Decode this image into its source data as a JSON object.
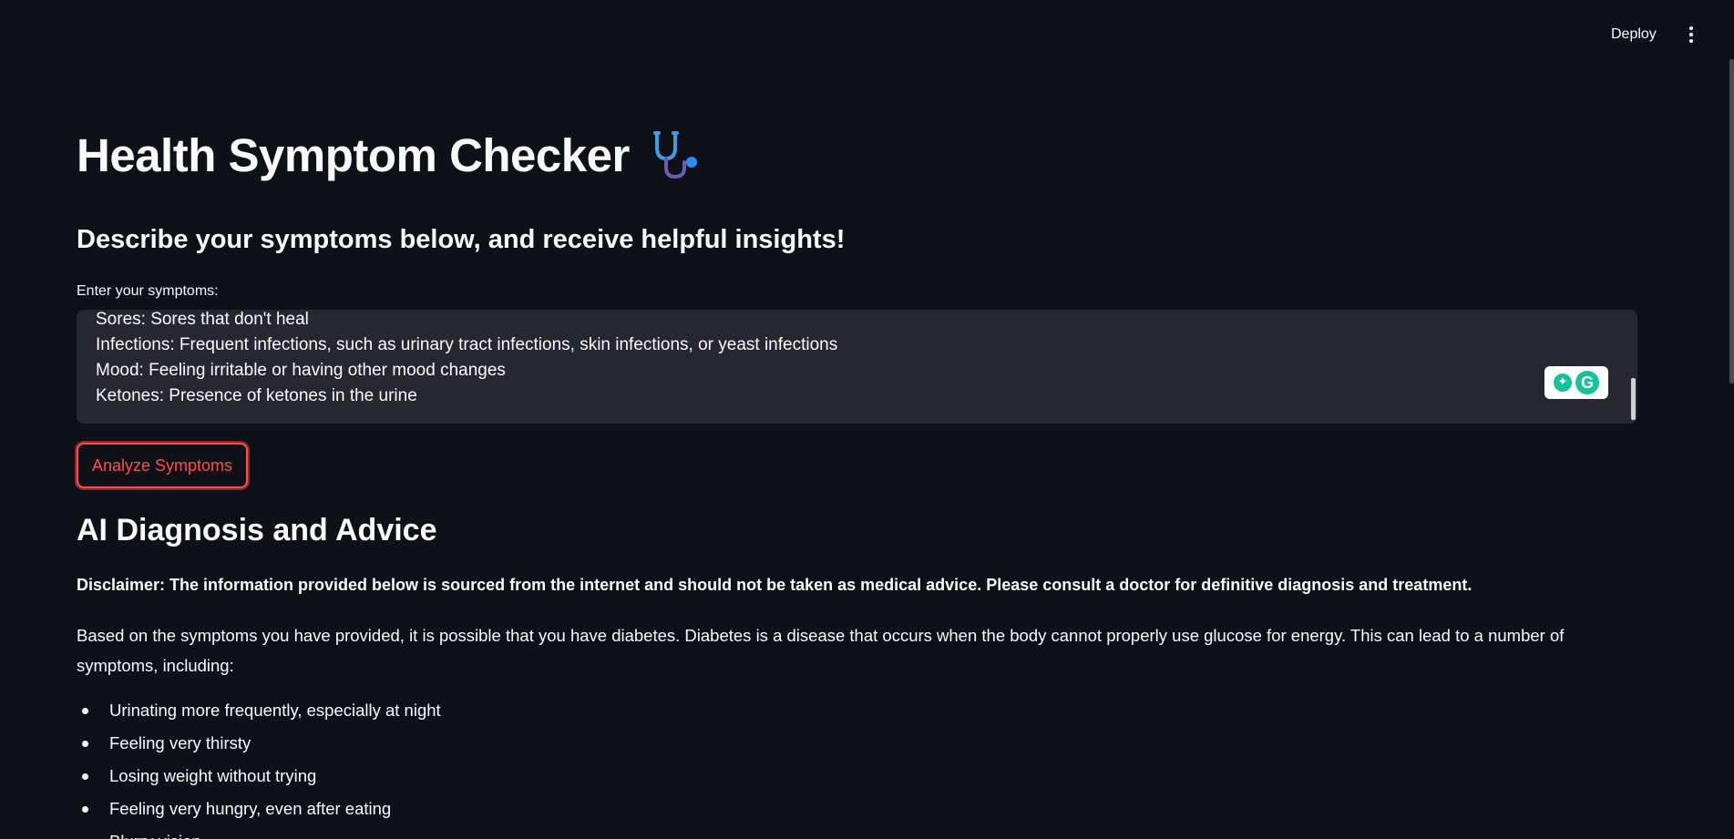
{
  "header": {
    "deploy_label": "Deploy",
    "menu_icon": "kebab-vertical-icon"
  },
  "main": {
    "title": "Health Symptom Checker",
    "title_icon": "stethoscope-icon",
    "subtitle": "Describe your symptoms below, and receive helpful insights!",
    "input": {
      "label": "Enter your symptoms:",
      "visible_lines": [
        "Sores: Sores that don't heal",
        "Infections: Frequent infections, such as urinary tract infections, skin infections, or yeast infections",
        "Mood: Feeling irritable or having other mood changes",
        "Ketones: Presence of ketones in the urine"
      ]
    },
    "analyze_button": "Analyze Symptoms",
    "result": {
      "heading": "AI Diagnosis and Advice",
      "disclaimer": "Disclaimer: The information provided below is sourced from the internet and should not be taken as medical advice. Please consult a doctor for definitive diagnosis and treatment.",
      "intro": "Based on the symptoms you have provided, it is possible that you have diabetes. Diabetes is a disease that occurs when the body cannot properly use glucose for energy. This can lead to a number of symptoms, including:",
      "symptoms": [
        "Urinating more frequently, especially at night",
        "Feeling very thirsty",
        "Losing weight without trying",
        "Feeling very hungry, even after eating",
        "Blurry vision"
      ]
    }
  },
  "colors": {
    "background": "#0e1117",
    "text": "#fafafa",
    "accent": "#ff4b4b",
    "input_bg": "#262730",
    "grammarly": "#15c39a"
  }
}
